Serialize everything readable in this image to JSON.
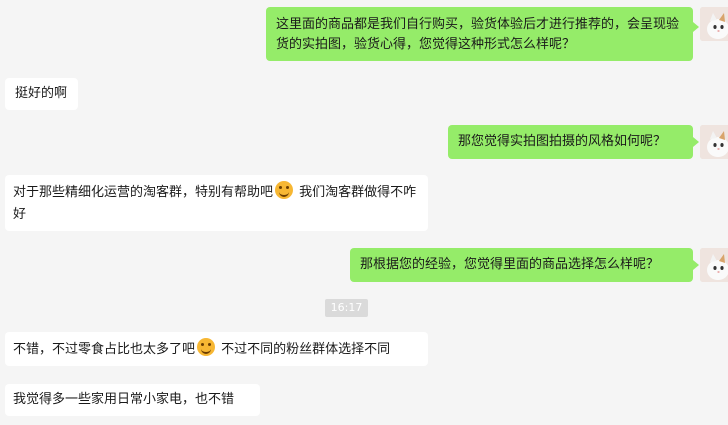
{
  "chat": {
    "messages": [
      {
        "from": "me",
        "text": "这里面的商品都是我们自行购买，验货体验后才进行推荐的，会呈现验货的实拍图，验货心得，您觉得这种形式怎么样呢？"
      },
      {
        "from": "other",
        "text": "挺好的啊"
      },
      {
        "from": "me",
        "text": "那您觉得实拍图拍摄的风格如何呢？"
      },
      {
        "from": "other",
        "text_before": "对于那些精细化运营的淘客群，特别有帮助吧",
        "emoji": "laugh-cry-emoji",
        "text_after": " 我们淘客群做得不咋好"
      },
      {
        "from": "me",
        "text": "那根据您的经验，您觉得里面的商品选择怎么样呢？"
      },
      {
        "from": "other",
        "text_before": "不错，不过零食占比也太多了吧",
        "emoji": "laugh-cry-emoji",
        "text_after": " 不过不同的粉丝群体选择不同"
      },
      {
        "from": "other",
        "text": "我觉得多一些家用日常小家电，也不错"
      }
    ],
    "timestamp": "16:17"
  },
  "colors": {
    "me_bubble": "#95ec69",
    "other_bubble": "#ffffff",
    "background": "#f5f5f5"
  }
}
